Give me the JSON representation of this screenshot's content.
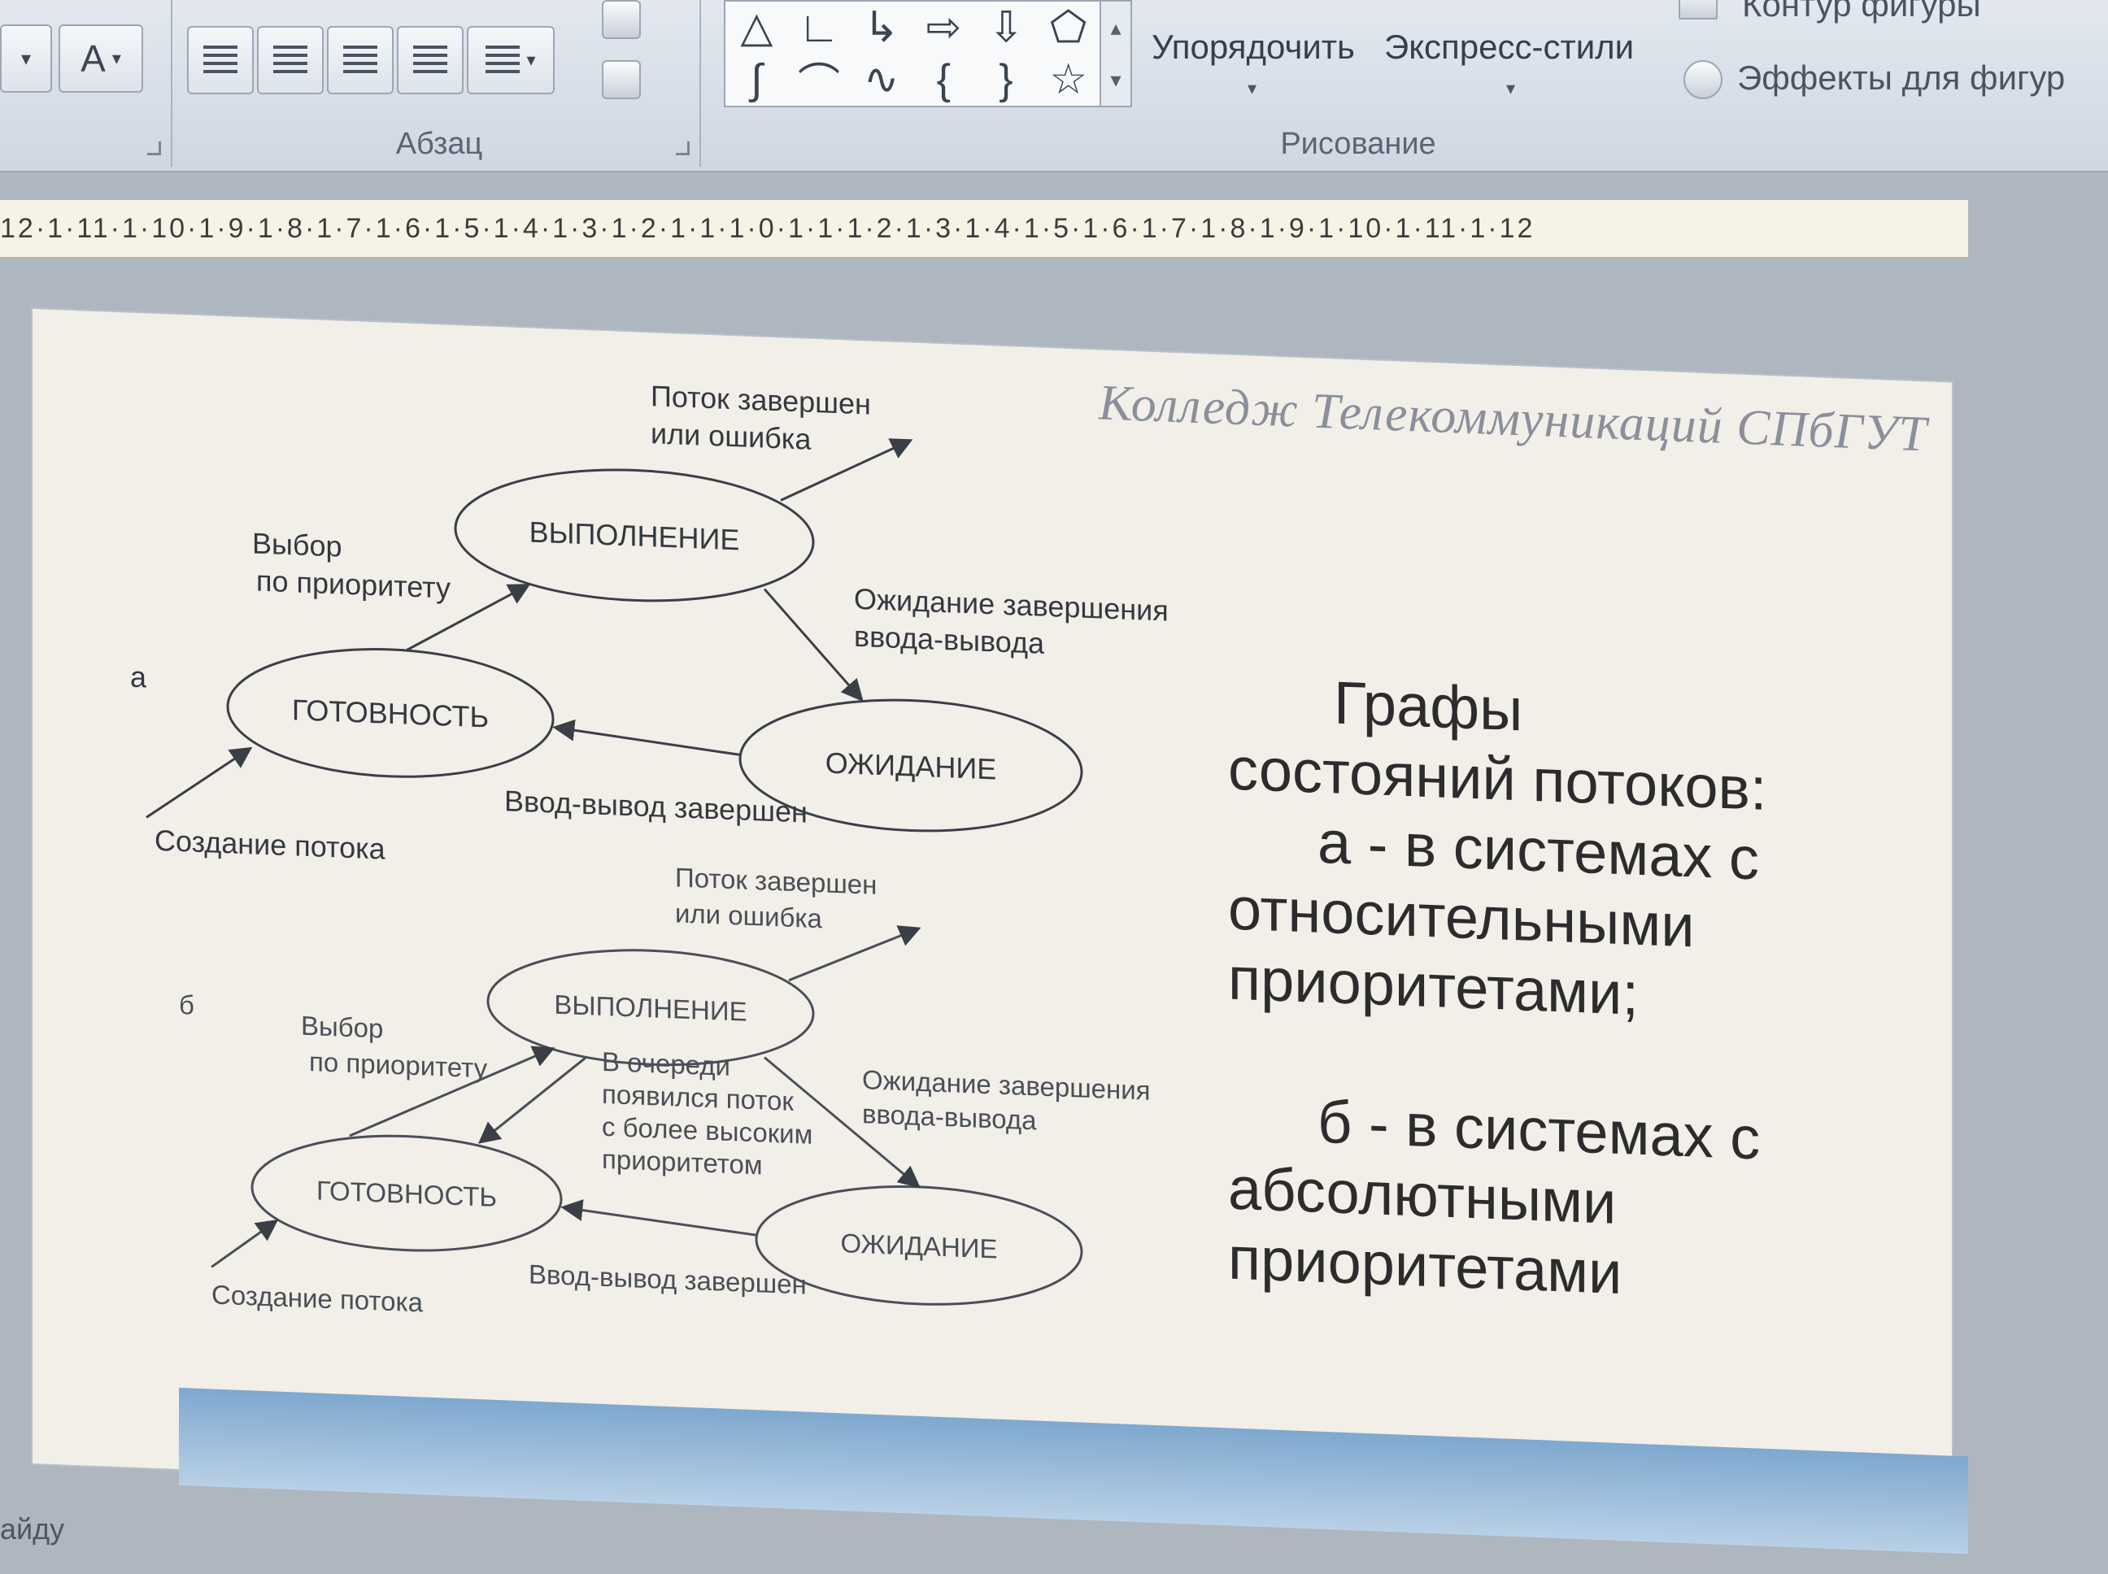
{
  "ribbon": {
    "font_letter": "A",
    "paragraph_group_label": "Абзац",
    "drawing_group_label": "Рисование",
    "arrange_label": "Упорядочить",
    "quick_styles_label": "Экспресс-стили",
    "shape_outline_label": "Контур фигуры",
    "shape_effects_label": "Эффекты для фигур"
  },
  "ruler": {
    "marks": "12·1·11·1·10·1·9·1·8·1·7·1·6·1·5·1·4·1·3·1·2·1·1·1·0·1·1·1·2·1·3·1·4·1·5·1·6·1·7·1·8·1·9·1·10·1·11·1·12"
  },
  "slide": {
    "header": "Колледж Телекоммуникаций СПбГУТ",
    "diagram_a": {
      "marker": "а",
      "states": {
        "running": "ВЫПОЛНЕНИЕ",
        "ready": "ГОТОВНОСТЬ",
        "waiting": "ОЖИДАНИЕ"
      },
      "labels": {
        "finish_1": "Поток завершен",
        "finish_2": "или ошибка",
        "select_1": "Выбор",
        "select_2": "по приоритету",
        "wait_1": "Ожидание завершения",
        "wait_2": "ввода-вывода",
        "io_done": "Ввод-вывод завершен",
        "create": "Создание потока"
      }
    },
    "diagram_b": {
      "marker": "б",
      "states": {
        "running": "ВЫПОЛНЕНИЕ",
        "ready": "ГОТОВНОСТЬ",
        "waiting": "ОЖИДАНИЕ"
      },
      "labels": {
        "finish_1": "Поток завершен",
        "finish_2": "или ошибка",
        "select_1": "Выбор",
        "select_2": "по приоритету",
        "preempt_1": "В очереди",
        "preempt_2": "появился поток",
        "preempt_3": "с более высоким",
        "preempt_4": "приоритетом",
        "wait_1": "Ожидание завершения",
        "wait_2": "ввода-вывода",
        "io_done": "Ввод-вывод завершен",
        "create": "Создание потока"
      }
    },
    "caption": {
      "line1": "Графы",
      "line2": "состояний потоков:",
      "line3": "а - в системах с",
      "line4": "относительными",
      "line5": "приоритетами;",
      "line6": "б - в системах с",
      "line7": "абсолютными",
      "line8": "приоритетами"
    }
  },
  "status_bar": {
    "text": "айду"
  },
  "colors": {
    "ribbon_bg": "#d9dfe7",
    "slide_bg": "#f1efe8",
    "diagram_ink": "#3a3f47",
    "footer_accent": "#7ea8cf"
  }
}
